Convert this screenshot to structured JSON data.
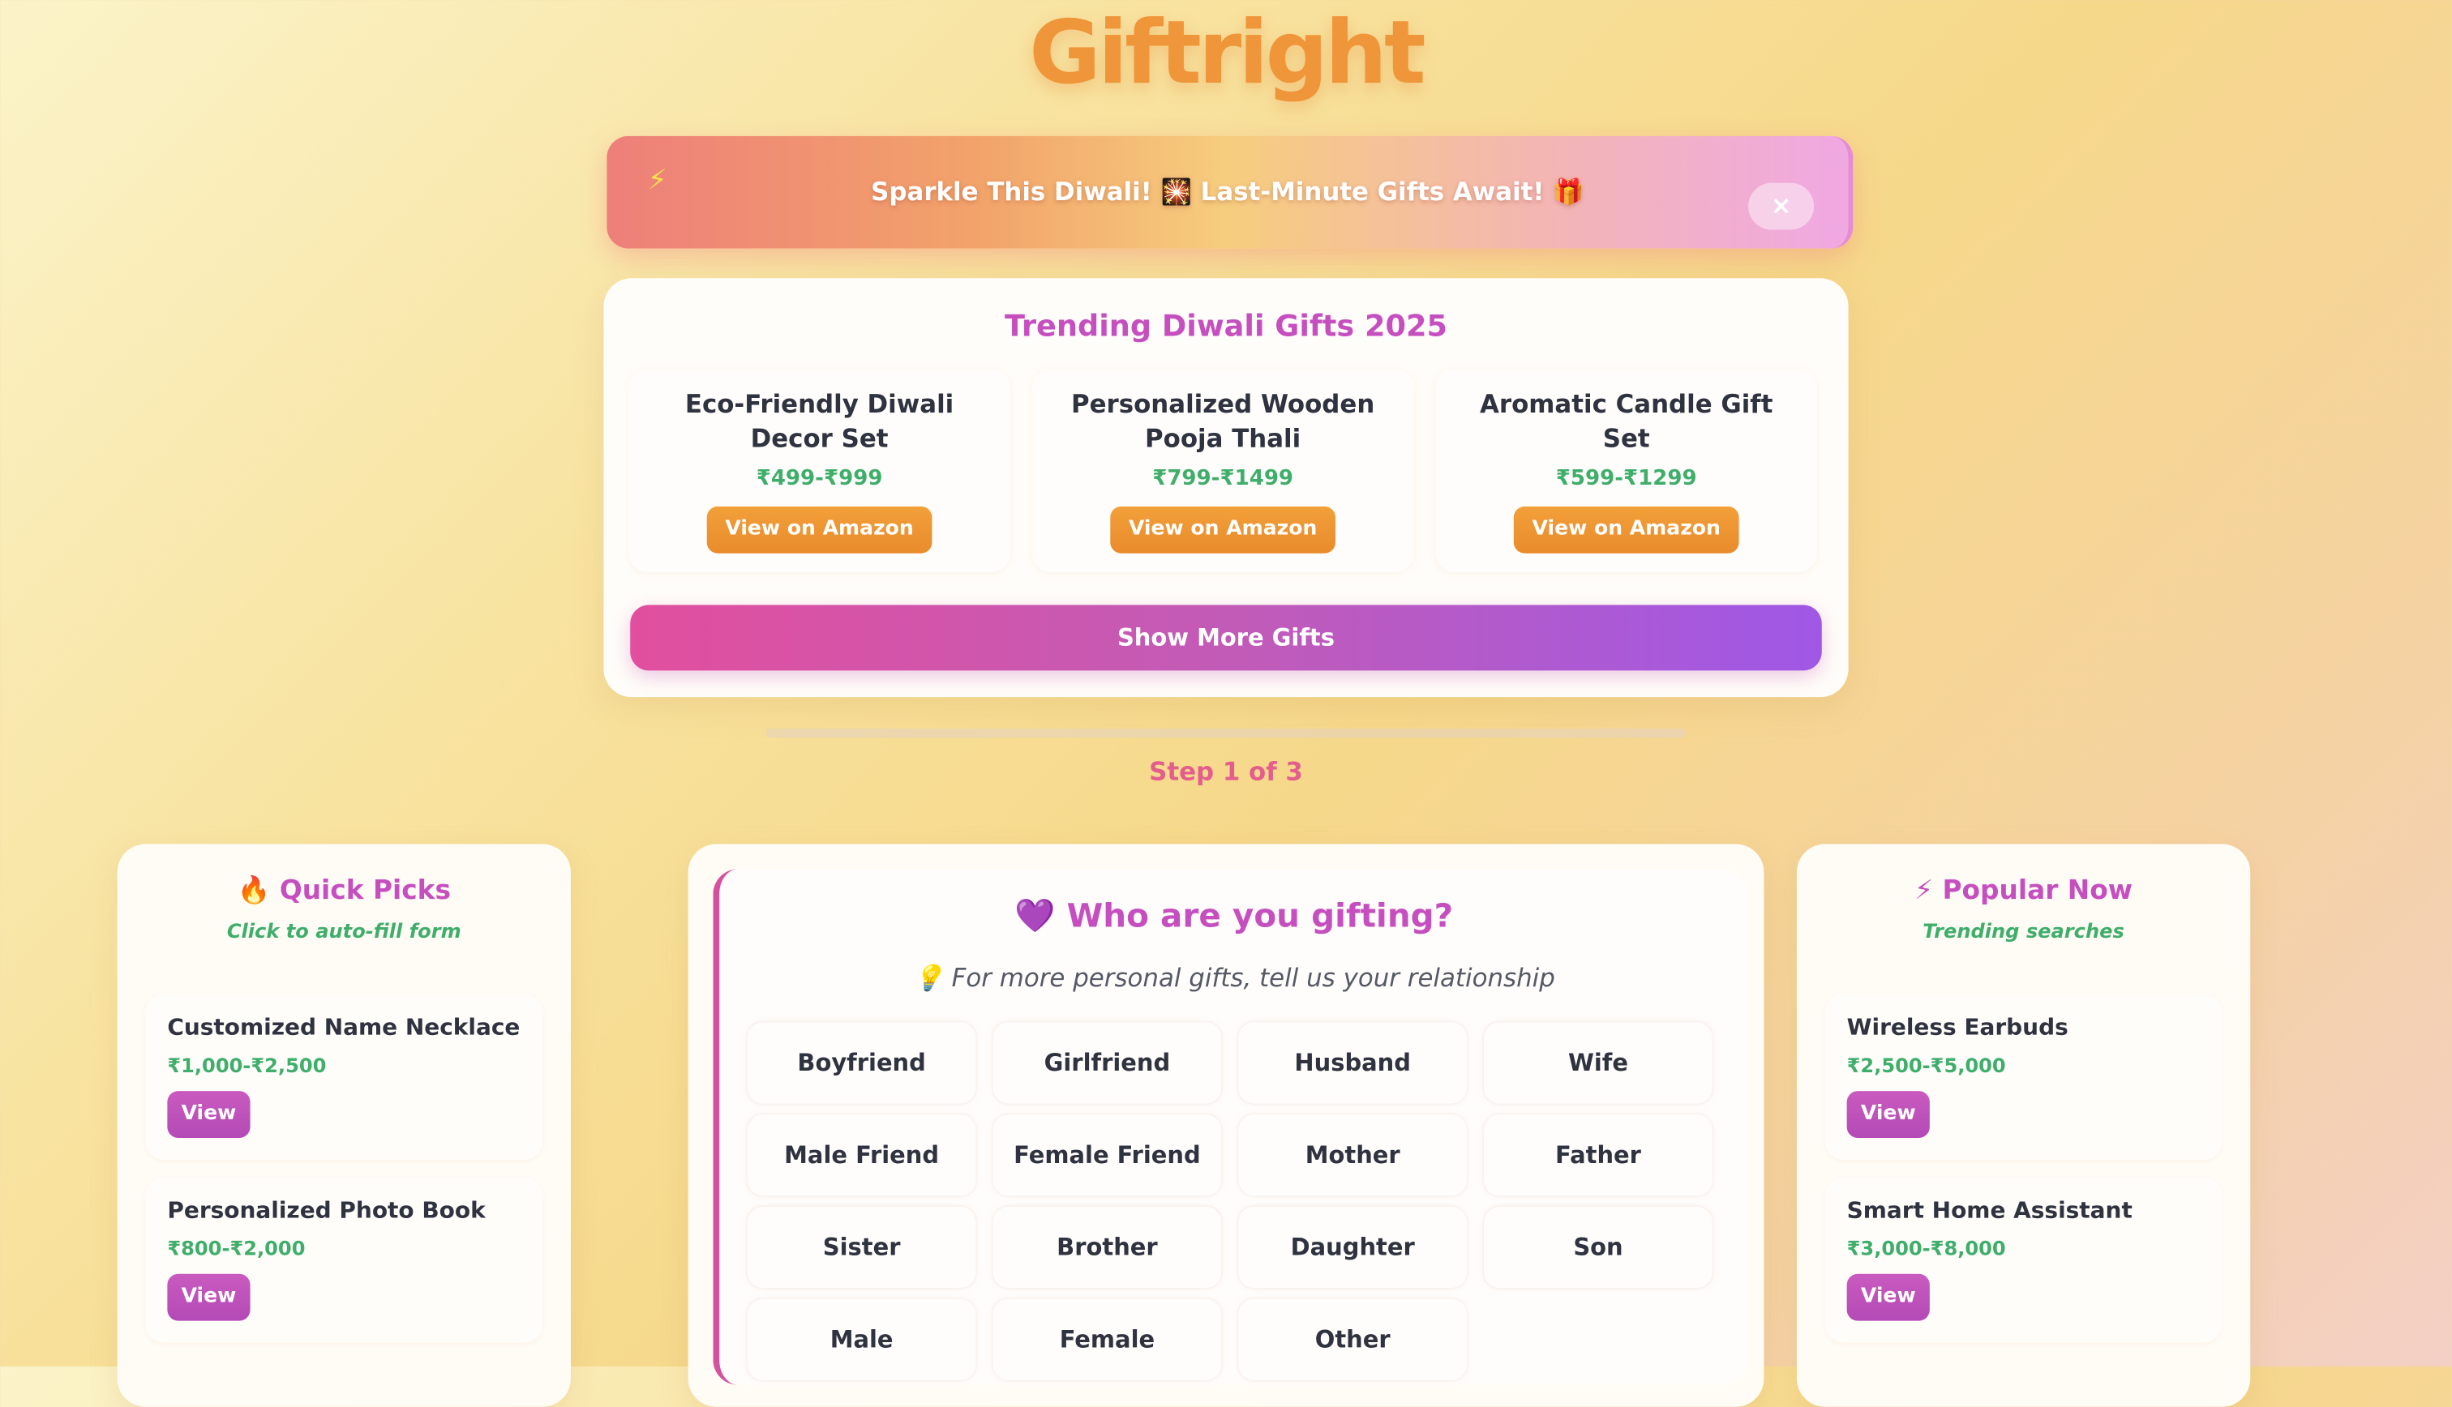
{
  "app": {
    "logo": "Giftright"
  },
  "banner": {
    "icon": "lightning-icon",
    "text": "Sparkle This Diwali! 🎇 Last-Minute Gifts Await! 🎁",
    "close_label": "×"
  },
  "trending": {
    "title": "Trending Diwali Gifts 2025",
    "items": [
      {
        "name": "Eco-Friendly Diwali Decor Set",
        "price": "₹499-₹999",
        "button": "View on Amazon"
      },
      {
        "name": "Personalized Wooden Pooja Thali",
        "price": "₹799-₹1499",
        "button": "View on Amazon"
      },
      {
        "name": "Aromatic Candle Gift Set",
        "price": "₹599-₹1299",
        "button": "View on Amazon"
      }
    ],
    "show_more": "Show More Gifts"
  },
  "progress": {
    "step_text": "Step 1 of 3",
    "fraction": 0.0
  },
  "quick_picks": {
    "title": "🔥 Quick Picks",
    "subtitle": "Click to auto-fill form",
    "items": [
      {
        "name": "Customized Name Necklace",
        "price": "₹1,000-₹2,500",
        "button": "View"
      },
      {
        "name": "Personalized Photo Book",
        "price": "₹800-₹2,000",
        "button": "View"
      }
    ]
  },
  "gifting": {
    "title": "💜 Who are you gifting?",
    "hint": "💡 For more personal gifts, tell us your relationship",
    "options": [
      "Boyfriend",
      "Girlfriend",
      "Husband",
      "Wife",
      "Male Friend",
      "Female Friend",
      "Mother",
      "Father",
      "Sister",
      "Brother",
      "Daughter",
      "Son",
      "Male",
      "Female",
      "Other"
    ]
  },
  "popular": {
    "title": "⚡ Popular Now",
    "subtitle": "Trending searches",
    "items": [
      {
        "name": "Wireless Earbuds",
        "price": "₹2,500-₹5,000",
        "button": "View"
      },
      {
        "name": "Smart Home Assistant",
        "price": "₹3,000-₹8,000",
        "button": "View"
      }
    ]
  }
}
